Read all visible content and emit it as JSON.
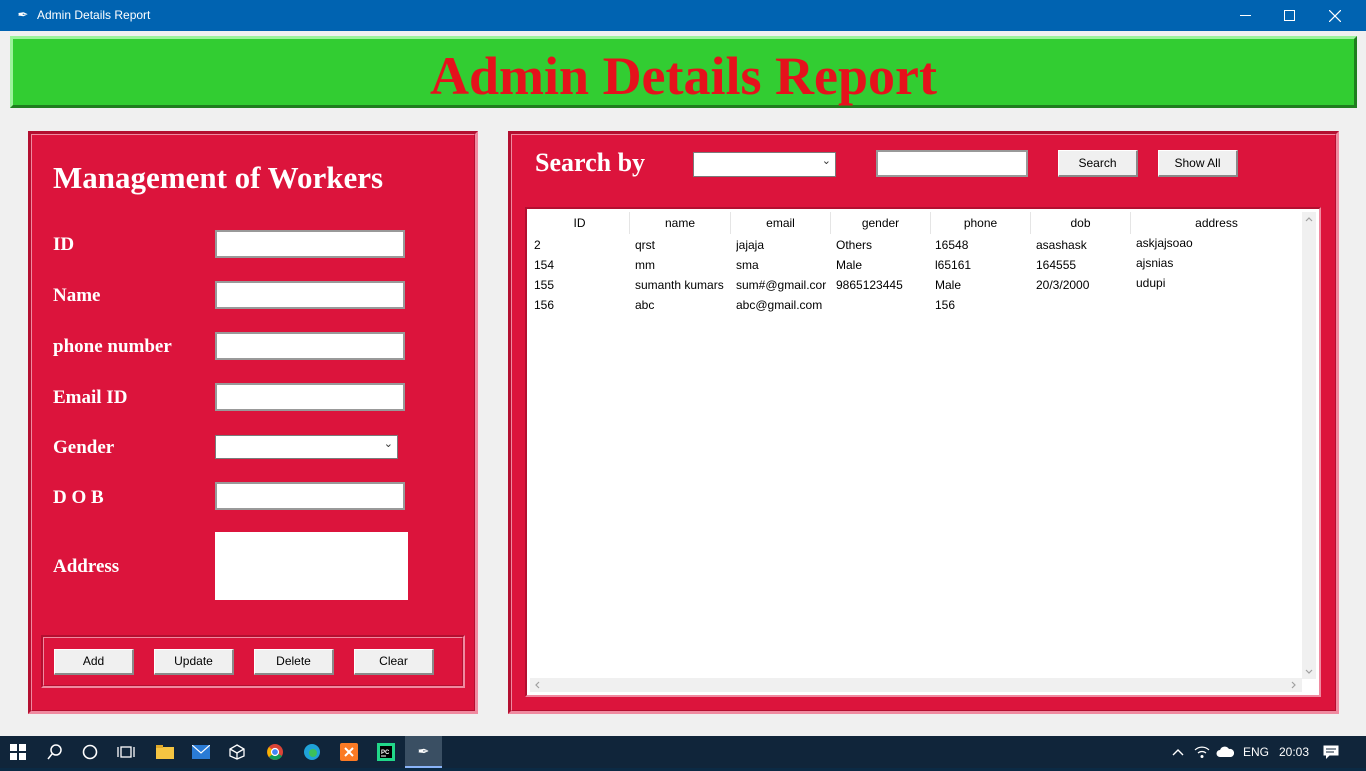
{
  "window": {
    "title": "Admin Details Report",
    "app_icon": "feather-icon"
  },
  "banner": {
    "title": "Admin Details Report"
  },
  "form": {
    "heading": "Management of Workers",
    "fields": {
      "id": {
        "label": "ID",
        "value": ""
      },
      "name": {
        "label": "Name",
        "value": ""
      },
      "phone": {
        "label": "phone number",
        "value": ""
      },
      "email": {
        "label": "Email ID",
        "value": ""
      },
      "gender": {
        "label": "Gender",
        "value": ""
      },
      "dob": {
        "label": "D O B",
        "value": ""
      },
      "address": {
        "label": "Address",
        "value": ""
      }
    },
    "buttons": {
      "add": "Add",
      "update": "Update",
      "delete": "Delete",
      "clear": "Clear"
    }
  },
  "search": {
    "label": "Search by",
    "by_value": "",
    "text_value": "",
    "search_button": "Search",
    "show_all_button": "Show All"
  },
  "table": {
    "columns": [
      "ID",
      "name",
      "email",
      "gender",
      "phone",
      "dob",
      "address"
    ],
    "rows": [
      [
        "2",
        "qrst",
        "jajaja",
        "Others",
        "16548",
        "asashask",
        "askjajsoao"
      ],
      [
        "154",
        "mm",
        "sma",
        "Male",
        "l65161",
        "164555",
        "ajsnias"
      ],
      [
        "155",
        "sumanth kumars",
        "sum#@gmail.cor",
        "9865123445",
        "Male",
        "20/3/2000",
        "udupi"
      ],
      [
        "156",
        "abc",
        "abc@gmail.com",
        "",
        "156",
        "",
        ""
      ]
    ]
  },
  "taskbar": {
    "language": "ENG",
    "time": "20:03"
  },
  "colors": {
    "panel": "#dc143c",
    "banner": "#32cd32",
    "banner_text": "#e5121c",
    "titlebar": "#0063b1"
  }
}
